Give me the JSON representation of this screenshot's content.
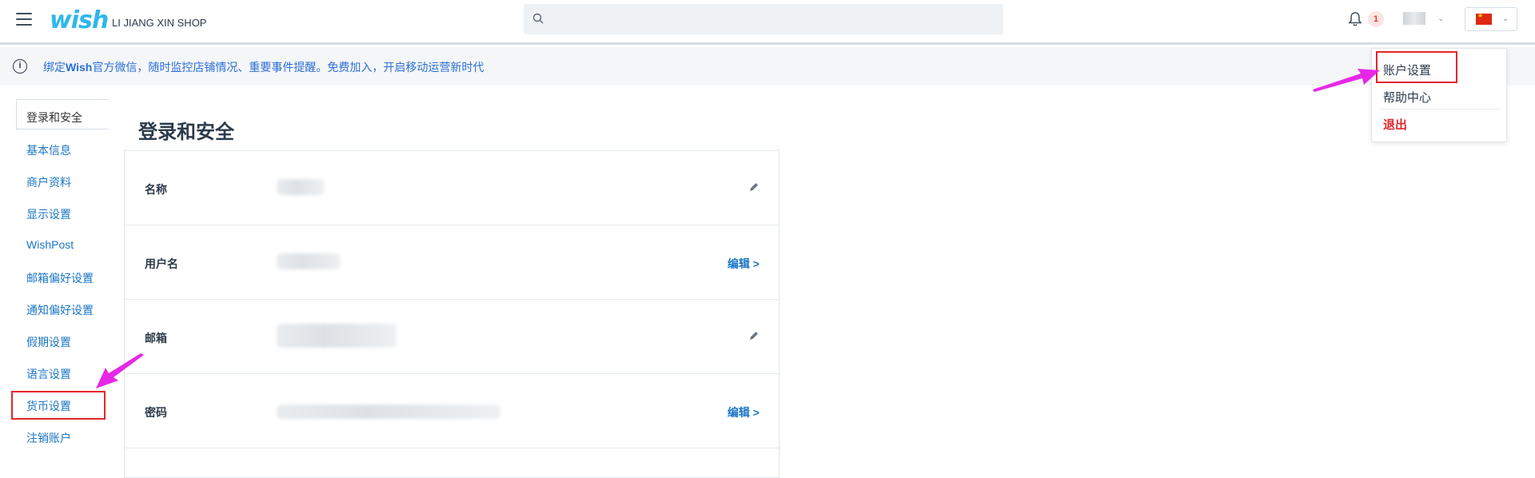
{
  "header": {
    "logo_text": "wish",
    "shop_name": "LI JIANG XIN SHOP",
    "search_placeholder": "",
    "notification_count": "1"
  },
  "notice": {
    "prefix": "绑定",
    "brand": "Wish",
    "text": "官方微信，随时监控店铺情况、重要事件提醒。免费加入，开启移动运营新时代"
  },
  "sidebar": {
    "active": "登录和安全",
    "items": [
      "基本信息",
      "商户资料",
      "显示设置",
      "WishPost",
      "邮箱偏好设置",
      "通知偏好设置",
      "假期设置",
      "语言设置",
      "货币设置",
      "注销账户"
    ]
  },
  "main": {
    "title": "登录和安全",
    "rows": [
      {
        "label": "名称",
        "action": ""
      },
      {
        "label": "用户名",
        "action": "编辑 >"
      },
      {
        "label": "邮箱",
        "action": ""
      },
      {
        "label": "密码",
        "action": "编辑 >"
      }
    ]
  },
  "dropdown": {
    "items": [
      "账户设置",
      "帮助中心"
    ],
    "logout": "退出"
  },
  "colors": {
    "brand": "#2fb7ec",
    "link": "#1b76c6",
    "highlight": "#e4262b",
    "arrow": "#e628e6"
  }
}
